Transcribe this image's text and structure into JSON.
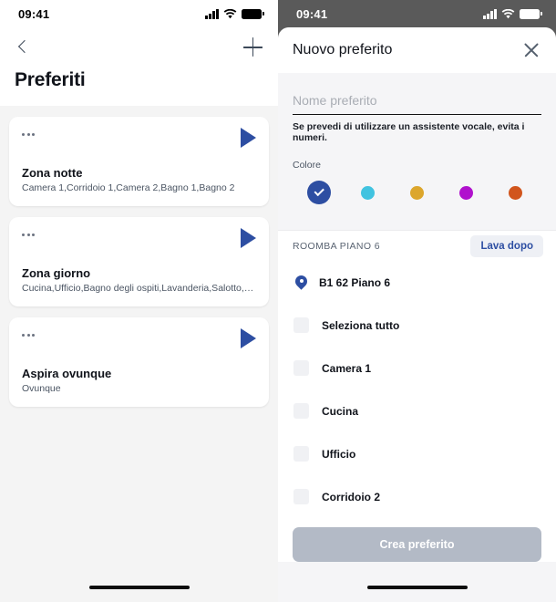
{
  "left_screen": {
    "status_bar": {
      "time": "09:41",
      "cellular_icon": "cellular-signal-icon",
      "wifi_icon": "wifi-icon",
      "battery_icon": "battery-full-icon"
    },
    "nav": {
      "back_icon": "chevron-left-icon",
      "add_icon": "plus-icon"
    },
    "page_title": "Preferiti",
    "favorites": [
      {
        "menu_icon": "overflow-menu-icon",
        "play_icon": "play-icon",
        "name": "Zona notte",
        "rooms": "Camera 1,Corridoio 1,Camera 2,Bagno 1,Bagno 2"
      },
      {
        "menu_icon": "overflow-menu-icon",
        "play_icon": "play-icon",
        "name": "Zona giorno",
        "rooms": "Cucina,Ufficio,Bagno degli ospiti,Lavanderia,Salotto,C..."
      },
      {
        "menu_icon": "overflow-menu-icon",
        "play_icon": "play-icon",
        "name": "Aspira ovunque",
        "rooms": "Ovunque"
      }
    ]
  },
  "right_screen": {
    "status_bar": {
      "time": "09:41",
      "cellular_icon": "cellular-signal-icon",
      "wifi_icon": "wifi-icon",
      "battery_icon": "battery-full-icon"
    },
    "sheet": {
      "title": "Nuovo preferito",
      "close_icon": "close-icon",
      "name_field": {
        "value": "",
        "placeholder": "Nome preferito"
      },
      "helper_text": "Se prevedi di utilizzare un assistente vocale, evita i numeri.",
      "color_label": "Colore",
      "colors": [
        {
          "name": "blue",
          "hex": "#2d4ea2",
          "selected": true,
          "check_icon": "check-icon"
        },
        {
          "name": "cyan",
          "hex": "#41c3e0",
          "selected": false
        },
        {
          "name": "yellow",
          "hex": "#dca62c",
          "selected": false
        },
        {
          "name": "purple",
          "hex": "#b011cd",
          "selected": false
        },
        {
          "name": "orange",
          "hex": "#d1551d",
          "selected": false
        }
      ],
      "section": {
        "title": "ROOMBA PIANO 6",
        "action_label": "Lava dopo"
      },
      "rooms": [
        {
          "label": "B1 62 Piano 6",
          "type": "location",
          "icon": "map-pin-icon",
          "checked": false
        },
        {
          "label": "Seleziona tutto",
          "type": "checkbox",
          "checked": false
        },
        {
          "label": "Camera 1",
          "type": "checkbox",
          "checked": false
        },
        {
          "label": "Cucina",
          "type": "checkbox",
          "checked": false
        },
        {
          "label": "Ufficio",
          "type": "checkbox",
          "checked": false
        },
        {
          "label": "Corridoio 2",
          "type": "checkbox",
          "checked": false
        }
      ],
      "submit_label": "Crea preferito"
    }
  },
  "theme": {
    "accent_blue": "#2d4ea2",
    "sheet_bg": "#f5f5f7",
    "disabled_button": "#b3bac6",
    "overlay": "#5a5a5a"
  }
}
